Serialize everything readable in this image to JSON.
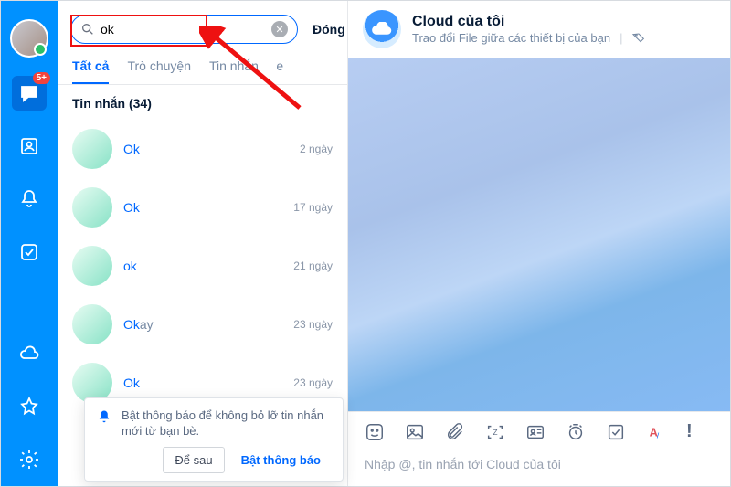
{
  "rail": {
    "badge": "5+"
  },
  "search": {
    "query": "ok",
    "close": "Đóng"
  },
  "tabs": {
    "all": "Tất cả",
    "chat": "Trò chuyện",
    "msg": "Tin nhắn",
    "more": "e"
  },
  "section": {
    "title": "Tin nhắn (34)"
  },
  "results": [
    {
      "hl": "Ok",
      "rest": "",
      "time": "2 ngày"
    },
    {
      "hl": "Ok",
      "rest": "",
      "time": "17 ngày"
    },
    {
      "hl": "ok",
      "rest": "",
      "time": "21 ngày"
    },
    {
      "hl": "Ok",
      "rest": "ay",
      "time": "23 ngày"
    },
    {
      "hl": "Ok",
      "rest": "",
      "time": "23 ngày"
    }
  ],
  "notif": {
    "text": "Bật thông báo để không bỏ lỡ tin nhắn mới từ bạn bè.",
    "later": "Để sau",
    "enable": "Bật thông báo"
  },
  "header": {
    "title": "Cloud của tôi",
    "subtitle": "Trao đổi File giữa các thiết bị của bạn"
  },
  "compose": {
    "placeholder": "Nhập @, tin nhắn tới Cloud của tôi"
  }
}
